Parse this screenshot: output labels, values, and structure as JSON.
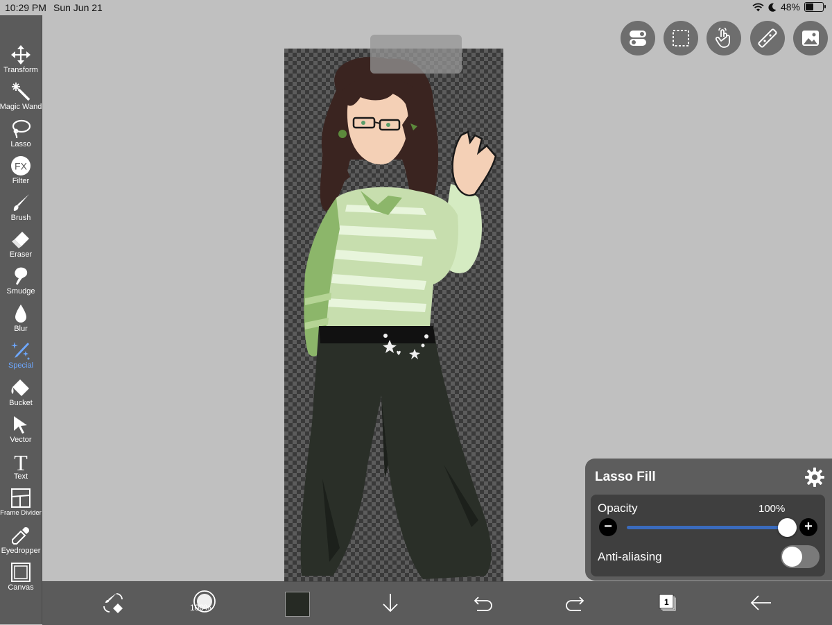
{
  "status_bar": {
    "time": "10:29 PM",
    "date": "Sun Jun 21",
    "battery": "48%",
    "battery_level": 0.48
  },
  "tools": [
    {
      "name": "transform",
      "label": "Transform"
    },
    {
      "name": "magic-wand",
      "label": "Magic Wand"
    },
    {
      "name": "lasso",
      "label": "Lasso"
    },
    {
      "name": "filter",
      "label": "Filter",
      "icon_text": "FX"
    },
    {
      "name": "brush",
      "label": "Brush"
    },
    {
      "name": "eraser",
      "label": "Eraser"
    },
    {
      "name": "smudge",
      "label": "Smudge"
    },
    {
      "name": "blur",
      "label": "Blur"
    },
    {
      "name": "special",
      "label": "Special",
      "active": true
    },
    {
      "name": "bucket",
      "label": "Bucket"
    },
    {
      "name": "vector",
      "label": "Vector"
    },
    {
      "name": "text",
      "label": "Text",
      "icon_text": "T"
    },
    {
      "name": "frame-divider",
      "label": "Frame Divider"
    },
    {
      "name": "eyedropper",
      "label": "Eyedropper"
    },
    {
      "name": "canvas",
      "label": "Canvas"
    }
  ],
  "top_buttons": [
    "toggle-icon",
    "selection-icon",
    "hand-icon",
    "ruler-icon",
    "image-icon"
  ],
  "lasso_panel": {
    "title": "Lasso Fill",
    "opacity_label": "Opacity",
    "opacity_value": "100%",
    "opacity_level": 1.0,
    "minus_label": "−",
    "plus_label": "+",
    "antialias_label": "Anti-aliasing",
    "antialias_on": false
  },
  "bottom_bar": {
    "brush_size": "100%",
    "current_color": "#262a24",
    "layers_count": "1"
  },
  "colors": {
    "accent": "#6ea8ff",
    "toolbar": "#5b5b5b",
    "background": "#c0c0c0",
    "slider": "#3a6bbd"
  }
}
